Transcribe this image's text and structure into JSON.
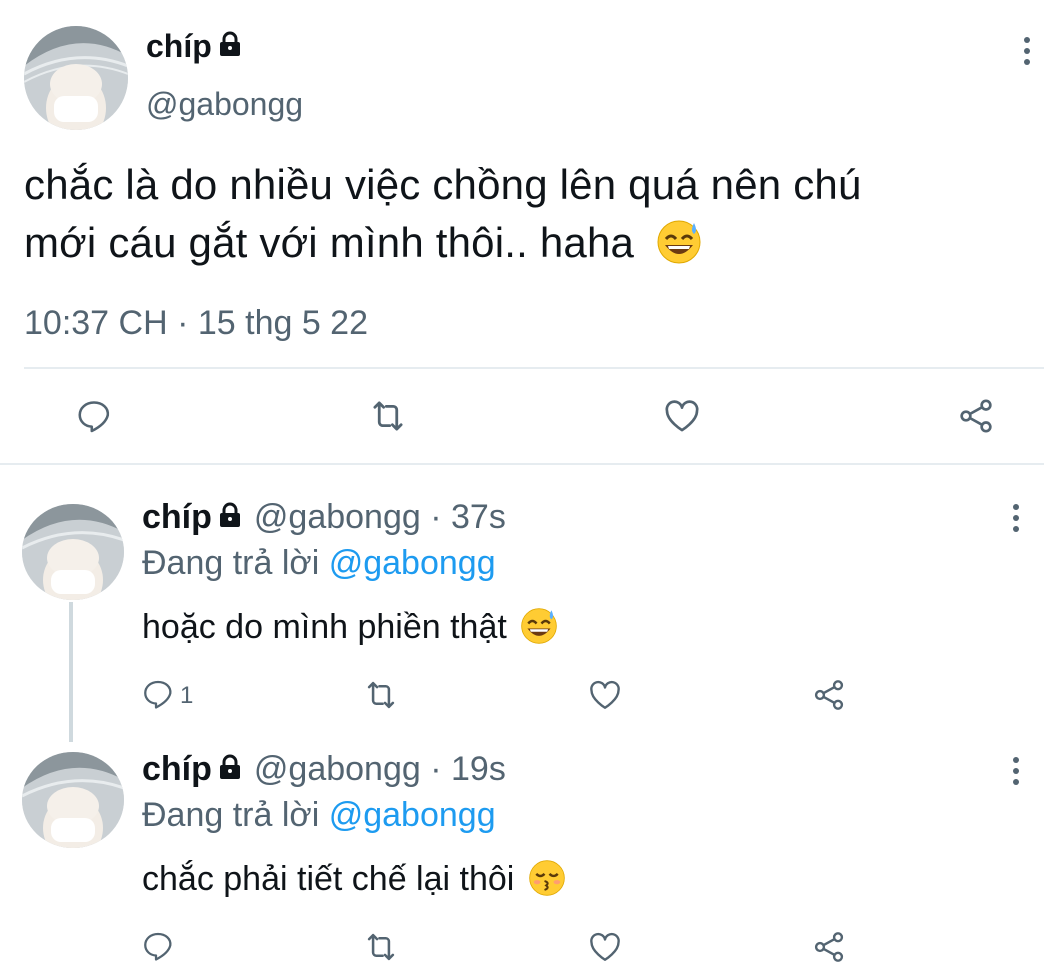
{
  "main_tweet": {
    "display_name": "chíp",
    "handle": "@gabongg",
    "text_line1": "chắc là do nhiều việc chồng lên quá nên chú",
    "text_line2": "mới cáu gắt với mình thôi.. haha",
    "emoji": "sweat-smile-emoji",
    "timestamp": "10:37 CH · 15 thg 5 22"
  },
  "replies": [
    {
      "display_name": "chíp",
      "handle": "@gabongg",
      "time": "· 37s",
      "replying_prefix": "Đang trả lời",
      "replying_to": "@gabongg",
      "text": "hoặc do mình phiền thật",
      "emoji": "sweat-smile-emoji",
      "reply_count": "1"
    },
    {
      "display_name": "chíp",
      "handle": "@gabongg",
      "time": "· 19s",
      "replying_prefix": "Đang trả lời",
      "replying_to": "@gabongg",
      "text": "chắc phải tiết chế lại thôi",
      "emoji": "kissing-closed-eyes-emoji",
      "reply_count": ""
    }
  ],
  "colors": {
    "accent": "#1d9bf0",
    "text": "#0f1419",
    "muted": "#536471",
    "divider": "#e6ecf0"
  }
}
